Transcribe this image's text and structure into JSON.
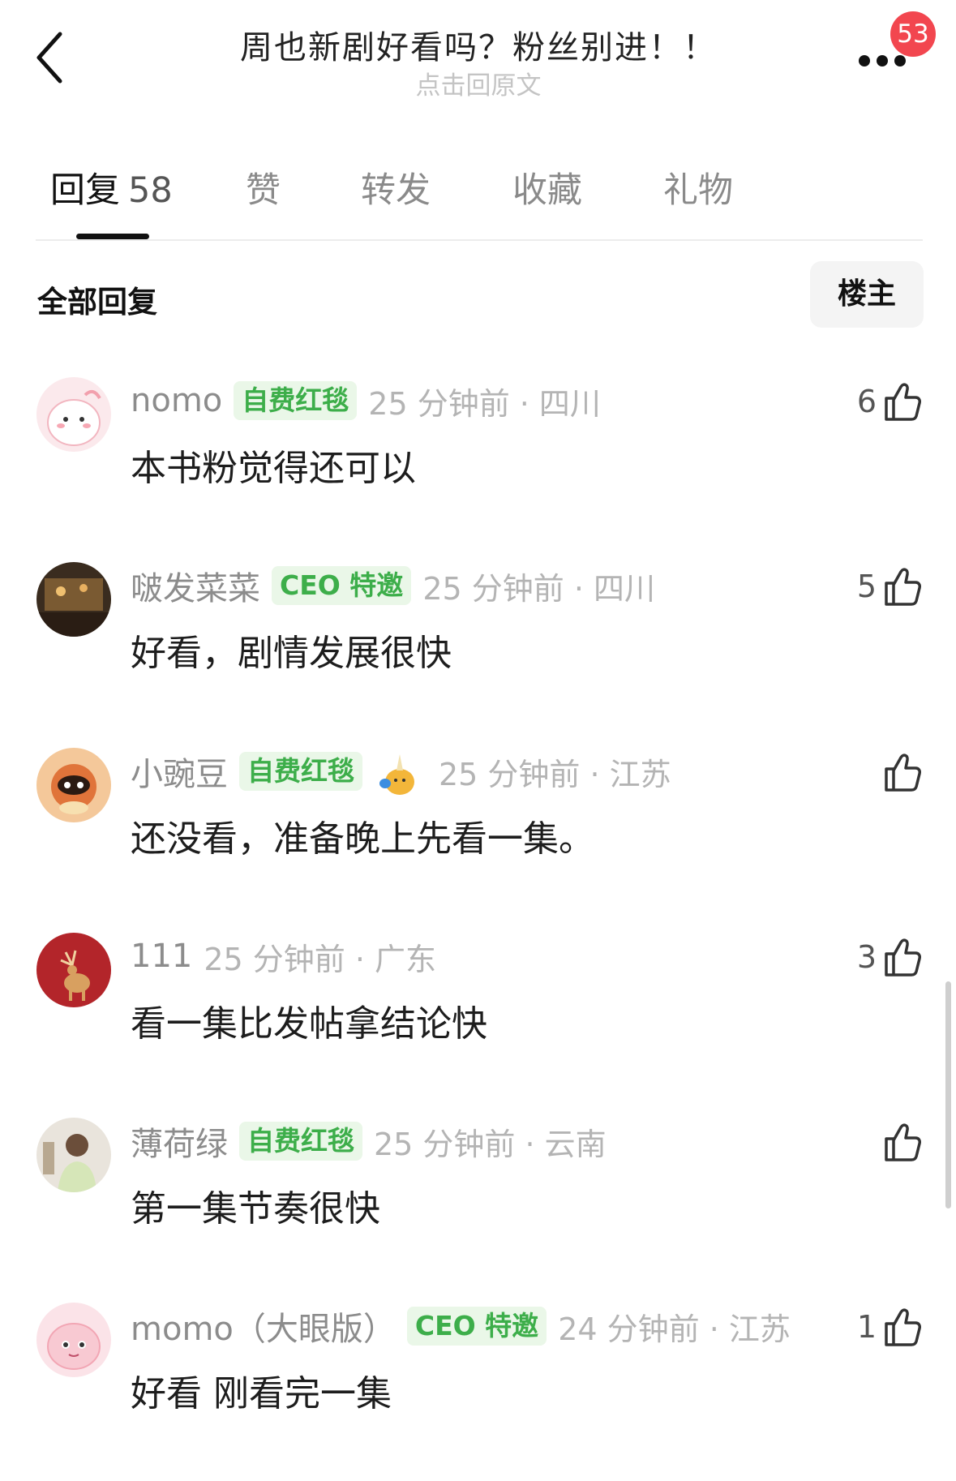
{
  "header": {
    "title": "周也新剧好看吗？粉丝别进！！",
    "subtitle": "点击回原文",
    "notification_count": "53",
    "badge_color": "#f2464f"
  },
  "tabs": [
    {
      "label": "回复",
      "count": "58",
      "active": true
    },
    {
      "label": "赞"
    },
    {
      "label": "转发"
    },
    {
      "label": "收藏"
    },
    {
      "label": "礼物"
    }
  ],
  "section": {
    "title": "全部回复",
    "filter_label": "楼主"
  },
  "comments": [
    {
      "username": "nomo",
      "tag": "自费红毯",
      "time": "25 分钟前 · 四川",
      "text": "本书粉觉得还可以",
      "likes": "6",
      "avatar": "pink-blob-avatar"
    },
    {
      "username": "啵发菜菜",
      "tag": "CEO 特邀",
      "time": "25 分钟前 · 四川",
      "text": "好看，剧情发展很快",
      "likes": "5",
      "avatar": "photo-avatar"
    },
    {
      "username": "小豌豆",
      "tag": "自费红毯",
      "time": "25 分钟前 · 江苏",
      "text": "还没看，准备晚上先看一集。",
      "likes": "",
      "avatar": "raccoon-avatar"
    },
    {
      "username": "111",
      "tag": "",
      "time": "25 分钟前 · 广东",
      "text": "看一集比发帖拿结论快",
      "likes": "3",
      "avatar": "deer-avatar"
    },
    {
      "username": "薄荷绿",
      "tag": "自费红毯",
      "time": "25 分钟前 · 云南",
      "text": "第一集节奏很快",
      "likes": "",
      "avatar": "photo-avatar"
    },
    {
      "username": "momo（大眼版）",
      "tag": "CEO 特邀",
      "time": "24 分钟前 · 江苏",
      "text": "好看 刚看完一集",
      "likes": "1",
      "avatar": "pink-blob-avatar"
    }
  ],
  "colors": {
    "tag_bg": "#eaf7e8",
    "tag_text": "#3dae4a"
  }
}
